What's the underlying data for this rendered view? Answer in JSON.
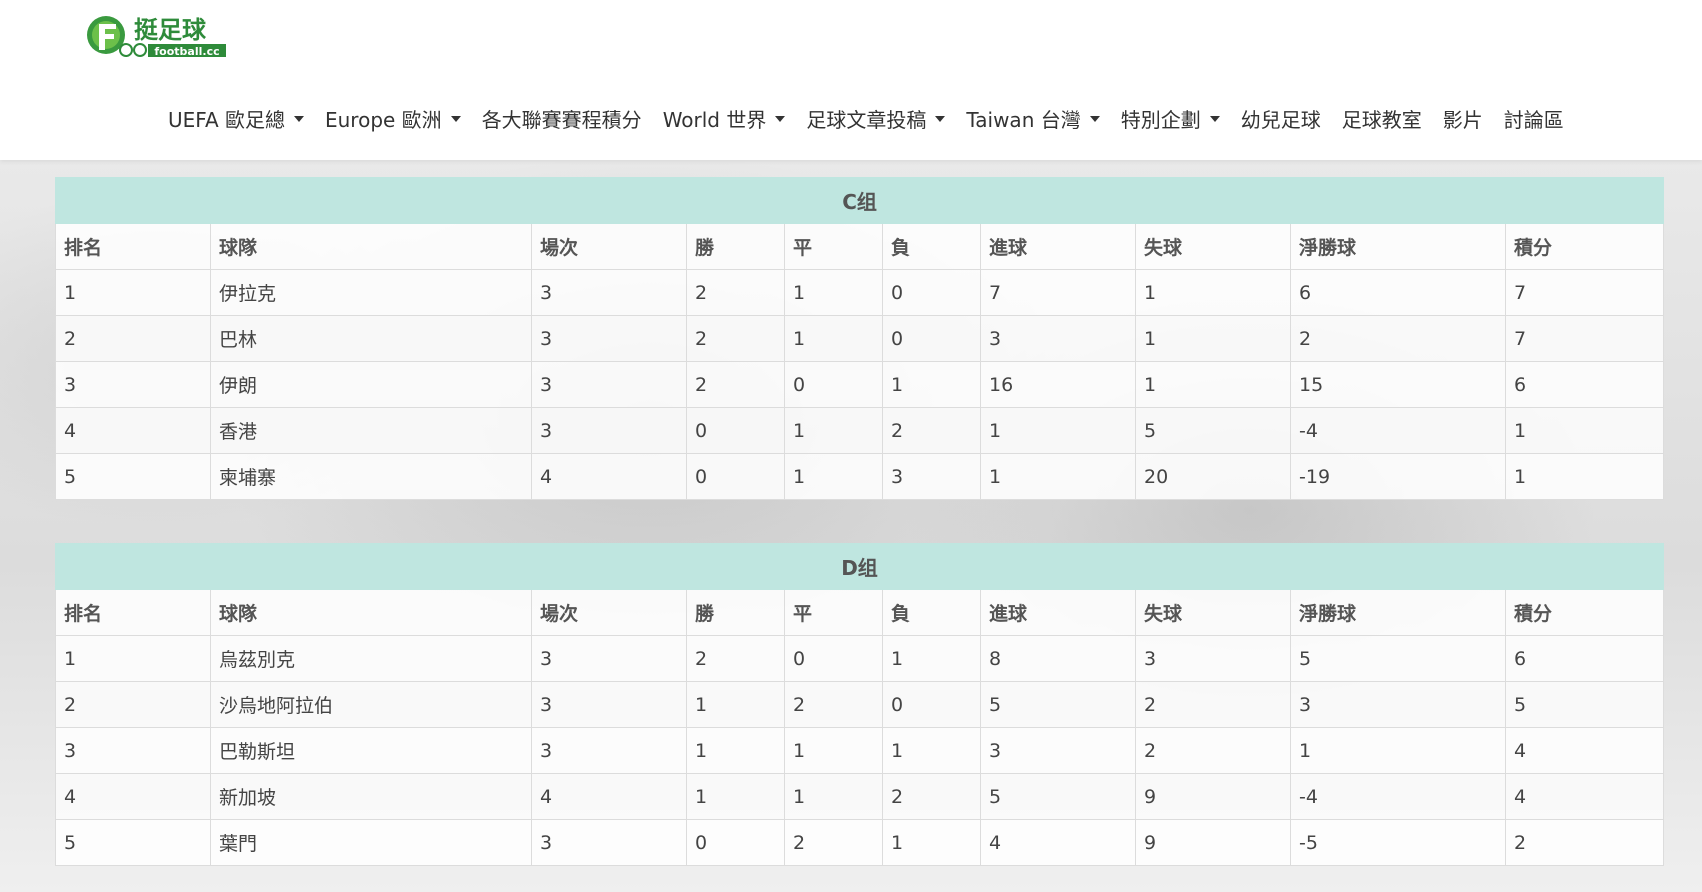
{
  "logo": {
    "text": "挺足球",
    "subtext": "football.cc"
  },
  "nav": [
    {
      "label": "UEFA 歐足總",
      "dropdown": true
    },
    {
      "label": "Europe 歐洲",
      "dropdown": true
    },
    {
      "label": "各大聯賽賽程積分",
      "dropdown": false
    },
    {
      "label": "World 世界",
      "dropdown": true
    },
    {
      "label": "足球文章投稿",
      "dropdown": true
    },
    {
      "label": "Taiwan 台灣",
      "dropdown": true
    },
    {
      "label": "特別企劃",
      "dropdown": true
    },
    {
      "label": "幼兒足球",
      "dropdown": false
    },
    {
      "label": "足球教室",
      "dropdown": false
    },
    {
      "label": "影片",
      "dropdown": false
    },
    {
      "label": "討論區",
      "dropdown": false
    }
  ],
  "columns": [
    "排名",
    "球隊",
    "場次",
    "勝",
    "平",
    "負",
    "進球",
    "失球",
    "淨勝球",
    "積分"
  ],
  "groups": [
    {
      "title": "C组",
      "rows": [
        [
          "1",
          "伊拉克",
          "3",
          "2",
          "1",
          "0",
          "7",
          "1",
          "6",
          "7"
        ],
        [
          "2",
          "巴林",
          "3",
          "2",
          "1",
          "0",
          "3",
          "1",
          "2",
          "7"
        ],
        [
          "3",
          "伊朗",
          "3",
          "2",
          "0",
          "1",
          "16",
          "1",
          "15",
          "6"
        ],
        [
          "4",
          "香港",
          "3",
          "0",
          "1",
          "2",
          "1",
          "5",
          "-4",
          "1"
        ],
        [
          "5",
          "柬埔寨",
          "4",
          "0",
          "1",
          "3",
          "1",
          "20",
          "-19",
          "1"
        ]
      ]
    },
    {
      "title": "D组",
      "rows": [
        [
          "1",
          "烏茲別克",
          "3",
          "2",
          "0",
          "1",
          "8",
          "3",
          "5",
          "6"
        ],
        [
          "2",
          "沙烏地阿拉伯",
          "3",
          "1",
          "2",
          "0",
          "5",
          "2",
          "3",
          "5"
        ],
        [
          "3",
          "巴勒斯坦",
          "3",
          "1",
          "1",
          "1",
          "3",
          "2",
          "1",
          "4"
        ],
        [
          "4",
          "新加坡",
          "4",
          "1",
          "1",
          "2",
          "5",
          "9",
          "-4",
          "4"
        ],
        [
          "5",
          "葉門",
          "3",
          "0",
          "2",
          "1",
          "4",
          "9",
          "-5",
          "2"
        ]
      ]
    }
  ],
  "colors": {
    "group_header_bg": "#bfe6e0",
    "logo_green": "#2e8b3a"
  }
}
